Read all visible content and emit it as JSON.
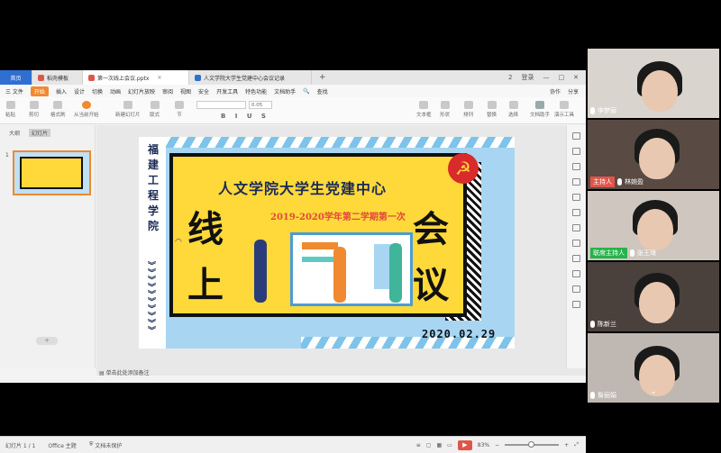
{
  "tabs": [
    {
      "label": "首页",
      "type": "home"
    },
    {
      "label": "稻壳模板",
      "color": "#e0554a"
    },
    {
      "label": "第一次线上会议.pptx",
      "color": "#e0554a",
      "active": true
    },
    {
      "label": "人文学院大学生党建中心会议记录",
      "color": "#2f6fd1"
    }
  ],
  "window_controls": [
    "2",
    "登录",
    "—",
    "□",
    "✕"
  ],
  "menu": {
    "file": "三 文件",
    "items": [
      "开始",
      "插入",
      "设计",
      "切换",
      "动画",
      "幻灯片放映",
      "审阅",
      "视图",
      "安全",
      "开发工具",
      "特色功能",
      "文档助手"
    ],
    "active": "开始",
    "search": "查找",
    "right": [
      "协作",
      "分享"
    ]
  },
  "ribbon": {
    "items": [
      "粘贴",
      "剪切",
      "格式刷",
      "从当前开始",
      "新建幻灯片",
      "版式",
      "节",
      "文本框",
      "形状",
      "排列",
      "替换",
      "选择",
      "文档助手",
      "演示工具"
    ],
    "font_size": "0.05"
  },
  "sidebar": {
    "tabs": [
      "大纲",
      "幻灯片"
    ],
    "selected_tab": "幻灯片",
    "slide_number": "1",
    "add_button": "+"
  },
  "slide": {
    "college": "福建工程学院",
    "headline": "人文学院大学生党建中心",
    "subline": "2019-2020学年第二学期第一次",
    "big_chars": [
      "线",
      "上",
      "会",
      "议"
    ],
    "date": "2020.02.29",
    "emblem": "☭"
  },
  "notes_placeholder": "单击此处添加备注",
  "status": {
    "slide_count": "幻灯片 1 / 1",
    "theme": "Office 主题",
    "backup": "文档未保护",
    "zoom": "83%"
  },
  "participants": [
    {
      "name": "李梦丽",
      "role": ""
    },
    {
      "name": "林婉盈",
      "role": "主持人"
    },
    {
      "name": "张王琦",
      "role": "联席主持人"
    },
    {
      "name": "陈新兰",
      "role": ""
    },
    {
      "name": "詹丽娟",
      "role": ""
    }
  ]
}
